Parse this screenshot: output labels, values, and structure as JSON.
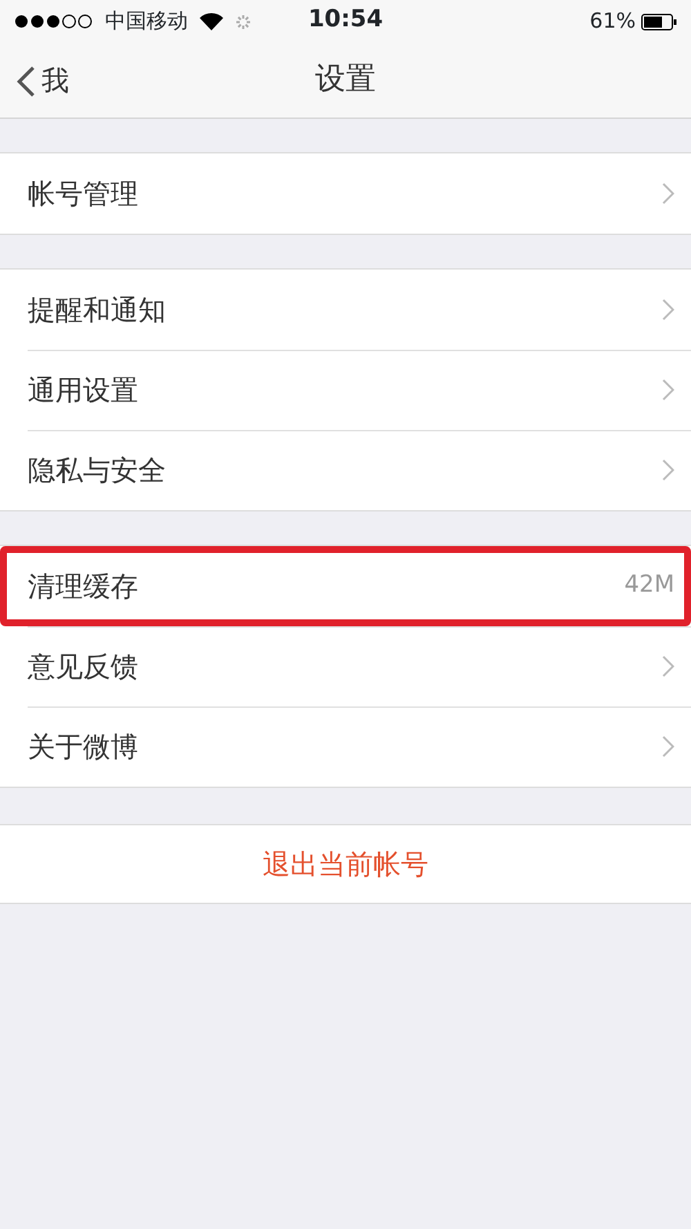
{
  "status_bar": {
    "carrier": "中国移动",
    "time": "10:54",
    "battery": "61%"
  },
  "nav": {
    "back": "我",
    "title": "设置"
  },
  "groups": [
    {
      "rows": [
        {
          "label": "帐号管理",
          "kind": "link",
          "highlighted": false
        }
      ]
    },
    {
      "rows": [
        {
          "label": "提醒和通知",
          "kind": "link",
          "highlighted": false
        },
        {
          "label": "通用设置",
          "kind": "link",
          "highlighted": false
        },
        {
          "label": "隐私与安全",
          "kind": "link",
          "highlighted": false
        }
      ]
    },
    {
      "rows": [
        {
          "label": "清理缓存",
          "kind": "value",
          "value": "42M",
          "highlighted": true
        },
        {
          "label": "意见反馈",
          "kind": "link",
          "highlighted": false
        },
        {
          "label": "关于微博",
          "kind": "link",
          "highlighted": false
        }
      ]
    }
  ],
  "logout": "退出当前帐号"
}
